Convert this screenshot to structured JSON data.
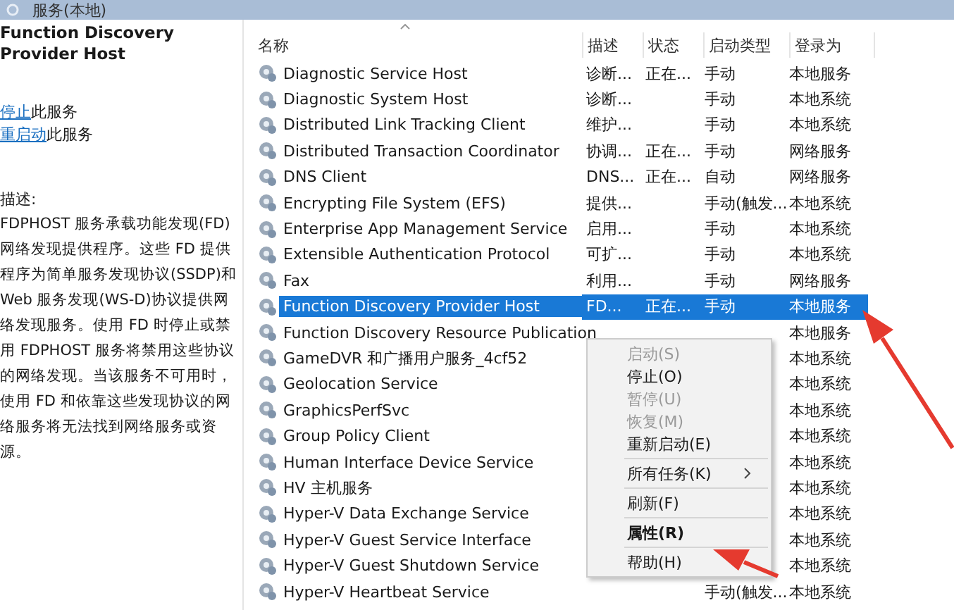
{
  "header": {
    "title": "服务(本地)"
  },
  "detail": {
    "service_name": "Function Discovery Provider Host",
    "actions": [
      {
        "link": "停止",
        "text": "此服务"
      },
      {
        "link": "重启动",
        "text": "此服务"
      }
    ],
    "description_label": "描述:",
    "description": "FDPHOST 服务承载功能发现(FD)网络发现提供程序。这些 FD 提供程序为简单服务发现协议(SSDP)和 Web 服务发现(WS-D)协议提供网络发现服务。使用 FD 时停止或禁用 FDPHOST 服务将禁用这些协议的网络发现。当该服务不可用时，使用 FD 和依靠这些发现协议的网络服务将无法找到网络服务或资源。"
  },
  "table": {
    "columns": [
      "名称",
      "描述",
      "状态",
      "启动类型",
      "登录为"
    ],
    "rows": [
      {
        "name": "Diagnostic Service Host",
        "description": "诊断...",
        "status": "正在...",
        "startup_type": "手动",
        "logon": "本地服务",
        "selected": false
      },
      {
        "name": "Diagnostic System Host",
        "description": "诊断...",
        "startup_type": "手动",
        "logon": "本地系统",
        "selected": false
      },
      {
        "name": "Distributed Link Tracking Client",
        "description": "维护...",
        "startup_type": "手动",
        "logon": "本地系统",
        "selected": false
      },
      {
        "name": "Distributed Transaction Coordinator",
        "description": "协调...",
        "status": "正在...",
        "startup_type": "手动",
        "logon": "网络服务",
        "selected": false
      },
      {
        "name": "DNS Client",
        "description": "DNS...",
        "status": "正在...",
        "startup_type": "自动",
        "logon": "网络服务",
        "selected": false
      },
      {
        "name": "Encrypting File System (EFS)",
        "description": "提供...",
        "startup_type": "手动(触发...",
        "logon": "本地系统",
        "selected": false
      },
      {
        "name": "Enterprise App Management Service",
        "description": "启用...",
        "startup_type": "手动",
        "logon": "本地系统",
        "selected": false
      },
      {
        "name": "Extensible Authentication Protocol",
        "description": "可扩...",
        "startup_type": "手动",
        "logon": "本地系统",
        "selected": false
      },
      {
        "name": "Fax",
        "description": "利用...",
        "startup_type": "手动",
        "logon": "网络服务",
        "selected": false
      },
      {
        "name": "Function Discovery Provider Host",
        "description": "FD...",
        "status": "正在...",
        "startup_type": "手动",
        "logon": "本地服务",
        "selected": true
      },
      {
        "name": "Function Discovery Resource Publication",
        "logon": "本地服务",
        "selected": false
      },
      {
        "name": "GameDVR 和广播用户服务_4cf52",
        "logon": "本地系统",
        "selected": false
      },
      {
        "name": "Geolocation Service",
        "logon": "本地系统",
        "selected": false
      },
      {
        "name": "GraphicsPerfSvc",
        "logon": "本地系统",
        "selected": false
      },
      {
        "name": "Group Policy Client",
        "logon": "本地系统",
        "selected": false
      },
      {
        "name": "Human Interface Device Service",
        "logon": "本地系统",
        "selected": false
      },
      {
        "name": "HV 主机服务",
        "logon": "本地系统",
        "selected": false
      },
      {
        "name": "Hyper-V Data Exchange Service",
        "logon": "本地系统",
        "selected": false
      },
      {
        "name": "Hyper-V Guest Service Interface",
        "logon": "本地系统",
        "selected": false
      },
      {
        "name": "Hyper-V Guest Shutdown Service",
        "logon": "本地系统",
        "selected": false
      },
      {
        "name": "Hyper-V Heartbeat Service",
        "startup_type": "手动(触发...",
        "logon": "本地系统",
        "selected": false
      }
    ]
  },
  "context_menu": {
    "items": [
      {
        "kind": "item",
        "label": "启动(S)",
        "disabled": true,
        "default": false
      },
      {
        "kind": "item",
        "label": "停止(O)",
        "disabled": false,
        "default": false
      },
      {
        "kind": "item",
        "label": "暂停(U)",
        "disabled": true,
        "default": false
      },
      {
        "kind": "item",
        "label": "恢复(M)",
        "disabled": true,
        "default": false
      },
      {
        "kind": "item",
        "label": "重新启动(E)",
        "disabled": false,
        "default": false
      },
      {
        "kind": "separator"
      },
      {
        "kind": "submenu",
        "label": "所有任务(K)",
        "disabled": false,
        "default": false
      },
      {
        "kind": "separator"
      },
      {
        "kind": "item",
        "label": "刷新(F)",
        "disabled": false,
        "default": false
      },
      {
        "kind": "separator"
      },
      {
        "kind": "item",
        "label": "属性(R)",
        "disabled": false,
        "default": true
      },
      {
        "kind": "separator"
      },
      {
        "kind": "item",
        "label": "帮助(H)",
        "disabled": false,
        "default": false
      }
    ]
  }
}
